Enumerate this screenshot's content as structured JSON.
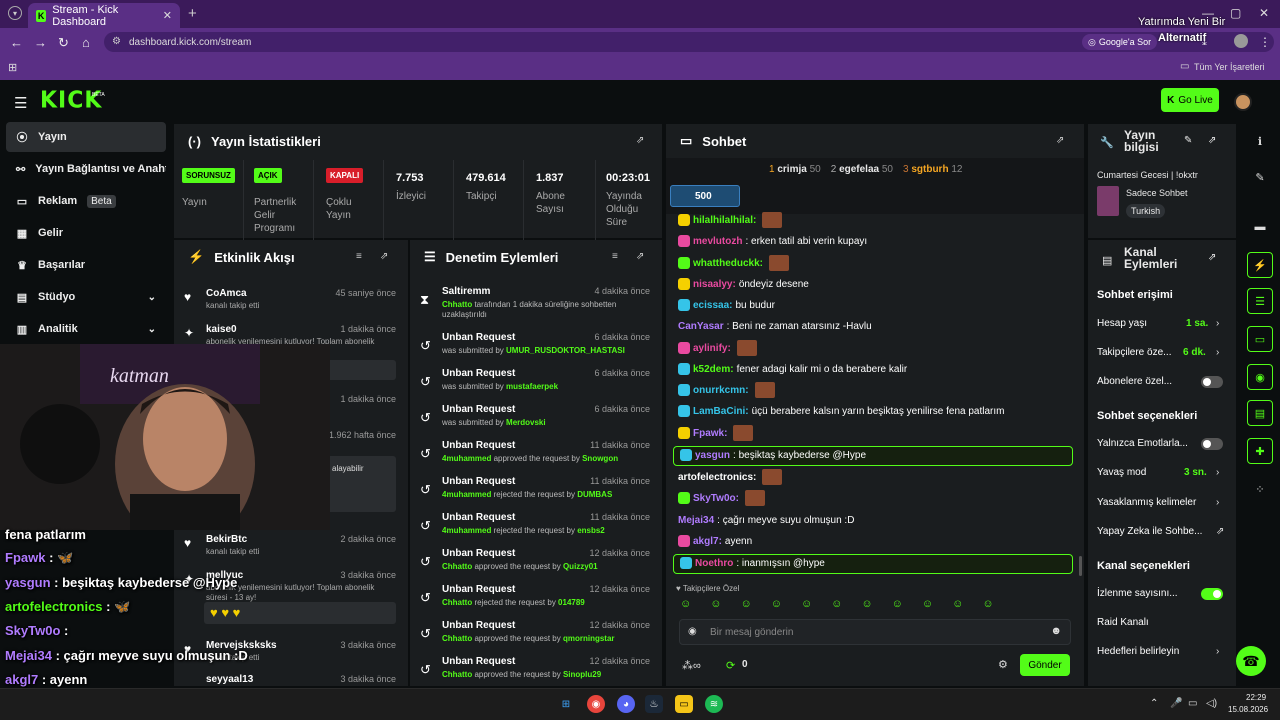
{
  "browser": {
    "tab_title": "Stream - Kick Dashboard",
    "url": "dashboard.kick.com/stream",
    "google_sor": "Google'a Sor",
    "bookmarks_all": "Tüm Yer İşaretleri",
    "ad_line1": "Yatırımda Yeni Bir",
    "ad_line2": "Alternatif"
  },
  "header": {
    "logo": "KICK",
    "beta": "BETA",
    "golive": "Go Live"
  },
  "nav": [
    {
      "label": "Yayın",
      "icon": "⦿"
    },
    {
      "label": "Yayın Bağlantısı ve Anahtar",
      "icon": "⚯"
    },
    {
      "label": "Reklam",
      "icon": "▭",
      "badge": "Beta"
    },
    {
      "label": "Gelir",
      "icon": "▦"
    },
    {
      "label": "Başarılar",
      "icon": "♛"
    },
    {
      "label": "Stüdyo",
      "icon": "▤",
      "chev": "⌄"
    },
    {
      "label": "Analitik",
      "icon": "▥",
      "chev": "⌄"
    }
  ],
  "stats": {
    "title": "Yayın İstatistikleri",
    "items": [
      {
        "tag": "SORUNSUZ",
        "label": "Yayın"
      },
      {
        "tag": "AÇIK",
        "label": "Partnerlik Gelir Programı"
      },
      {
        "tag": "KAPALI",
        "label": "Çoklu Yayın"
      },
      {
        "value": "7.753",
        "label": "İzleyici"
      },
      {
        "value": "479.614",
        "label": "Takipçi"
      },
      {
        "value": "1.837",
        "label": "Abone Sayısı"
      },
      {
        "value": "00:23:01",
        "label": "Yayında Olduğu Süre"
      }
    ]
  },
  "events": {
    "title": "Etkinlik Akışı",
    "rows": [
      {
        "name": "CoAmca",
        "time": "45 saniye önce",
        "sub": "kanalı takip etti"
      },
      {
        "name": "kaise0",
        "time": "1 dakika önce",
        "sub": "abonelik yenilemesini kutluyor! Toplam abonelik"
      },
      {
        "name": "",
        "time": "1 dakika önce",
        "sub": ""
      },
      {
        "name": "",
        "time": "1.962 hafta önce",
        "sub": "alayabilir"
      },
      {
        "name": "BekirBtc",
        "time": "2 dakika önce",
        "sub": "kanalı takip etti"
      },
      {
        "name": "mellyuc",
        "time": "3 dakika önce",
        "sub": "abonelik yenilemesini kutluyor! Toplam abonelik süresi - 13 ay!"
      },
      {
        "name": "Mervejsksksks",
        "time": "3 dakika önce",
        "sub": "kanalı takip etti"
      },
      {
        "name": "seyyaal13",
        "time": "3 dakika önce",
        "sub": ""
      }
    ]
  },
  "mod": {
    "title": "Denetim Eylemleri",
    "rows": [
      {
        "title": "Saltiremm",
        "time": "4 dakika önce",
        "pre": "Chhatto",
        "desc": " tarafından 1 dakika süreliğine sohbetten uzaklaştırıldı",
        "user": ""
      },
      {
        "title": "Unban Request",
        "time": "6 dakika önce",
        "pre": "",
        "desc": "was submitted by ",
        "user": "UMUR_RUSDOKTOR_HASTASI"
      },
      {
        "title": "Unban Request",
        "time": "6 dakika önce",
        "pre": "",
        "desc": "was submitted by ",
        "user": "mustafaerpek"
      },
      {
        "title": "Unban Request",
        "time": "6 dakika önce",
        "pre": "",
        "desc": "was submitted by ",
        "user": "Merdovski"
      },
      {
        "title": "Unban Request",
        "time": "11 dakika önce",
        "pre": "4muhammed",
        "desc": " approved the request by ",
        "user": "Snowgon"
      },
      {
        "title": "Unban Request",
        "time": "11 dakika önce",
        "pre": "4muhammed",
        "desc": " rejected the request by ",
        "user": "DUMBAS"
      },
      {
        "title": "Unban Request",
        "time": "11 dakika önce",
        "pre": "4muhammed",
        "desc": " rejected the request by ",
        "user": "ensbs2"
      },
      {
        "title": "Unban Request",
        "time": "12 dakika önce",
        "pre": "Chhatto",
        "desc": " approved the request by ",
        "user": "Quizzy01"
      },
      {
        "title": "Unban Request",
        "time": "12 dakika önce",
        "pre": "Chhatto",
        "desc": " rejected the request by ",
        "user": "014789"
      },
      {
        "title": "Unban Request",
        "time": "12 dakika önce",
        "pre": "Chhatto",
        "desc": " approved the request by ",
        "user": "qmorningstar"
      },
      {
        "title": "Unban Request",
        "time": "12 dakika önce",
        "pre": "Chhatto",
        "desc": " approved the request by ",
        "user": "Sinoplu29"
      }
    ]
  },
  "chat": {
    "title": "Sohbet",
    "leaders": [
      {
        "rank": "1",
        "name": "crimja",
        "n": "50"
      },
      {
        "rank": "2",
        "name": "egefelaa",
        "n": "50"
      },
      {
        "rank": "3",
        "name": "sgtburh",
        "n": "12"
      }
    ],
    "pinned": "500",
    "lines": [
      {
        "user": "hilalhilalhilal:",
        "color": "#53fc18",
        "msg": "",
        "emote": true
      },
      {
        "user": "mevlutozh",
        "color": "#e94aa0",
        "msg": ": erken tatil abi verin kupayı"
      },
      {
        "user": "whattheduckk:",
        "color": "#53fc18",
        "msg": "",
        "emote": true
      },
      {
        "user": "nisaalyy:",
        "color": "#e94aa0",
        "msg": " öndeyiz desene"
      },
      {
        "user": "ecissaa:",
        "color": "#35c4e8",
        "msg": " bu budur"
      },
      {
        "user": "CanYasar",
        "color": "#b07cff",
        "msg": ": Beni ne zaman atarsınız -Havlu"
      },
      {
        "user": "aylinify:",
        "color": "#e94aa0",
        "msg": "",
        "emote": true
      },
      {
        "user": "k52dem:",
        "color": "#53fc18",
        "msg": " fener adagi kalir mi o da berabere kalir"
      },
      {
        "user": "onurrkcmn:",
        "color": "#35c4e8",
        "msg": "",
        "emote": true
      },
      {
        "user": "LamBaCini:",
        "color": "#35c4e8",
        "msg": " üçü berabere kalsın yarın beşiktaş yenilirse fena patlarım"
      },
      {
        "user": "Fpawk:",
        "color": "#b07cff",
        "msg": "",
        "emote": true
      },
      {
        "user": "yasgun",
        "color": "#b07cff",
        "msg": ": beşiktaş kaybederse @Hype"
      },
      {
        "user": "artofelectronics:",
        "color": "#fff",
        "msg": "",
        "emote": true
      },
      {
        "user": "SkyTw0o:",
        "color": "#b07cff",
        "msg": "",
        "emote": true
      },
      {
        "user": "Mejai34",
        "color": "#b07cff",
        "msg": ": çağrı meyve suyu olmuşun :D"
      },
      {
        "user": "akgl7:",
        "color": "#b07cff",
        "msg": " ayenn"
      },
      {
        "user": "Noethro",
        "color": "#e94aa0",
        "msg": ": inanmışsın @hype"
      }
    ],
    "follower_only": "Takipçilere Özel",
    "placeholder": "Bir mesaj gönderin",
    "count": "0",
    "send": "Gönder"
  },
  "streaminfo": {
    "title": "Yayın bilgisi",
    "stream_title": "Cumartesi Gecesi | !okxtr",
    "category": "Sadece Sohbet",
    "tag": "Turkish"
  },
  "actions": {
    "title": "Kanal Eylemleri",
    "chat_access": "Sohbet erişimi",
    "account_age": "Hesap yaşı",
    "account_age_val": "1 sa.",
    "followers": "Takipçilere öze...",
    "followers_val": "6 dk.",
    "subs": "Abonelere özel...",
    "chat_opts": "Sohbet seçenekleri",
    "emote_only": "Yalnızca Emotlarla...",
    "slow": "Yavaş mod",
    "slow_val": "3 sn.",
    "banned_words": "Yasaklanmış kelimeler",
    "ai": "Yapay Zeka ile Sohbe...",
    "channel_opts": "Kanal seçenekleri",
    "viewer_count": "İzlenme sayısını...",
    "raid": "Raid Kanalı",
    "goals": "Hedefleri belirleyin"
  },
  "overlay": {
    "lines": [
      {
        "user": "",
        "msg": "fena patlarım",
        "color": "#fff"
      },
      {
        "user": "Fpawk",
        "msg": " : 🦋",
        "color": "#b07cff"
      },
      {
        "user": "yasgun",
        "msg": " : beşiktaş kaybederse @Hype",
        "color": "#b07cff"
      },
      {
        "user": "artofelectronics",
        "msg": " : 🦋",
        "color": "#53fc18"
      },
      {
        "user": "SkyTw0o",
        "msg": " :",
        "color": "#b07cff"
      },
      {
        "user": "Mejai34",
        "msg": " : çağrı meyve suyu olmuşun :D",
        "color": "#b07cff"
      },
      {
        "user": "akgl7",
        "msg": " : ayenn",
        "color": "#b07cff"
      },
      {
        "user": "Noethro",
        "msg": " : inanmışsın @hype",
        "color": "#e94aa0"
      }
    ]
  },
  "taskbar": {
    "time": "22:29",
    "date": "15.08.2026"
  }
}
